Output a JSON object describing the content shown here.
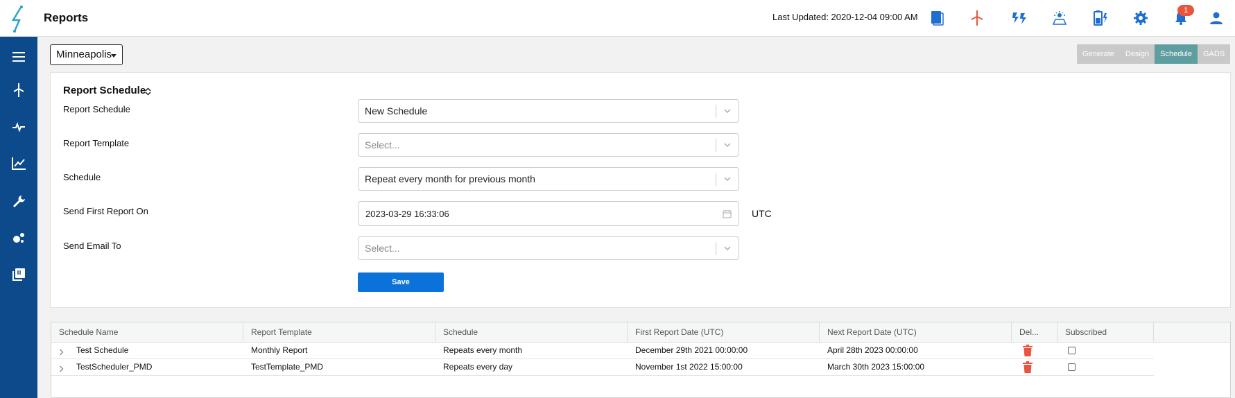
{
  "header": {
    "title": "Reports",
    "last_updated": "Last Updated: 2020-12-04 09:00 AM",
    "notification_count": "1",
    "icons": [
      "book-icon",
      "wind-turbine-icon",
      "power-flash-icon",
      "solar-icon",
      "battery-icon",
      "gear-icon",
      "bell-icon",
      "user-icon"
    ]
  },
  "sidebar": {
    "items": [
      "menu-icon",
      "wind-turbine-icon",
      "pulse-icon",
      "line-chart-icon",
      "wrench-icon",
      "bubbles-icon",
      "library-icon"
    ]
  },
  "site_selector": {
    "value": "Minneapolis"
  },
  "tabs": [
    {
      "label": "Generate",
      "active": false
    },
    {
      "label": "Design",
      "active": false
    },
    {
      "label": "Schedule",
      "active": true
    },
    {
      "label": "GADS",
      "active": false
    }
  ],
  "form": {
    "title": "Report Schedule",
    "fields": {
      "report_schedule": {
        "label": "Report Schedule",
        "value": "New Schedule"
      },
      "report_template": {
        "label": "Report Template",
        "placeholder": "Select..."
      },
      "schedule": {
        "label": "Schedule",
        "value": "Repeat every month for previous month"
      },
      "send_first": {
        "label": "Send First Report On",
        "value": "2023-03-29 16:33:06",
        "timezone": "UTC"
      },
      "send_email": {
        "label": "Send Email To",
        "placeholder": "Select..."
      }
    },
    "save_label": "Save"
  },
  "table": {
    "columns": [
      "Schedule Name",
      "Report Template",
      "Schedule",
      "First Report Date (UTC)",
      "Next Report Date (UTC)",
      "Del...",
      "Subscribed"
    ],
    "rows": [
      {
        "name": "Test Schedule",
        "template": "Monthly Report",
        "schedule": "Repeats every month",
        "first": "December 29th 2021 00:00:00",
        "next": "April 28th 2023 00:00:00",
        "subscribed": false
      },
      {
        "name": "TestScheduler_PMD",
        "template": "TestTemplate_PMD",
        "schedule": "Repeats every day",
        "first": "November 1st 2022 15:00:00",
        "next": "March 30th 2023 15:00:00",
        "subscribed": false
      }
    ]
  },
  "colors": {
    "sidebar": "#0d4a8c",
    "accent": "#0b72d9",
    "active_tab": "#5f9ea0",
    "alert": "#e8553e"
  }
}
